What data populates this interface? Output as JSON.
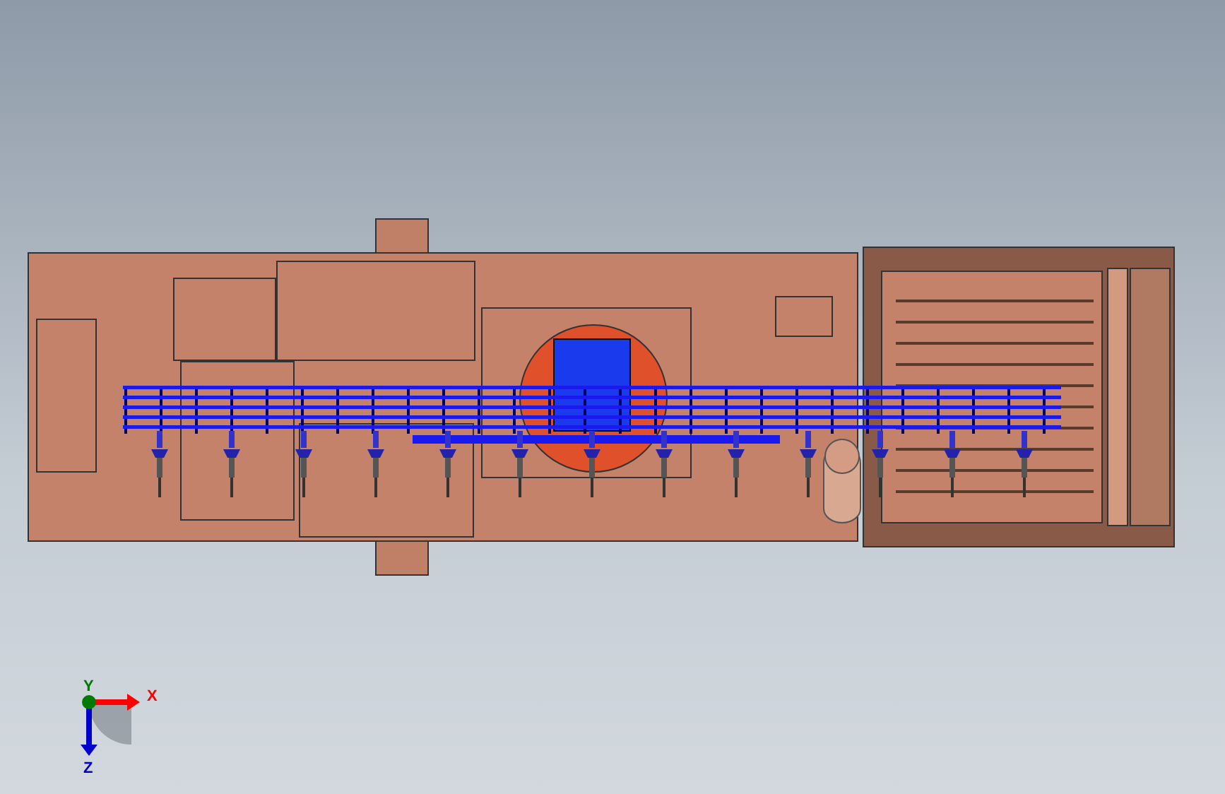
{
  "viewport": {
    "triad": {
      "axes": [
        {
          "label": "X",
          "color": "#ff0000"
        },
        {
          "label": "Y",
          "color": "#007a00"
        },
        {
          "label": "Z",
          "color": "#0000cc"
        }
      ]
    }
  }
}
